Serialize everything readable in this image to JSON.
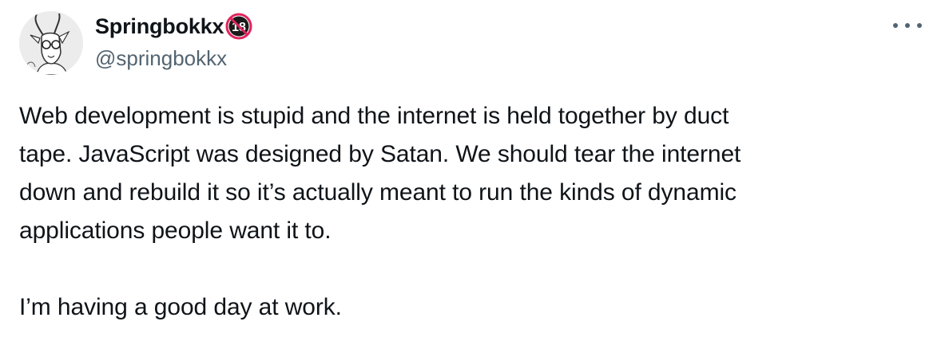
{
  "author": {
    "display_name": "Springbokkx",
    "handle": "@springbokkx",
    "badge_text": "18",
    "avatar_icon": "springbok-avatar-icon"
  },
  "menu": {
    "icon": "more-options-icon"
  },
  "tweet": {
    "paragraph1_lines": [
      "Web development is stupid and the internet is held together by duct",
      "tape. JavaScript was designed by Satan. We should tear the internet",
      "down and rebuild it so it’s actually meant to run the kinds of dynamic",
      "applications people want it to."
    ],
    "paragraph2": "I’m having a good day at work."
  },
  "colors": {
    "text": "#0f1419",
    "secondary": "#536471",
    "badge_red": "#e0245e"
  }
}
